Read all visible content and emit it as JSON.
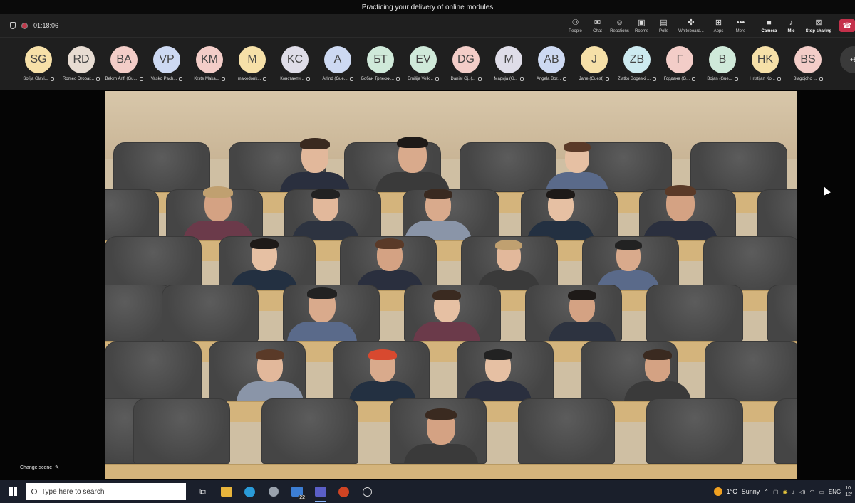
{
  "window": {
    "title": "Practicing your delivery of online modules"
  },
  "meeting": {
    "timer": "01:18:06",
    "toolbar": [
      {
        "id": "people",
        "icon": "people-icon",
        "glyph": "⚇",
        "label": "People"
      },
      {
        "id": "chat",
        "icon": "chat-icon",
        "glyph": "✉",
        "label": "Chat"
      },
      {
        "id": "reactions",
        "icon": "reactions-icon",
        "glyph": "☺",
        "label": "Reactions"
      },
      {
        "id": "rooms",
        "icon": "rooms-icon",
        "glyph": "▣",
        "label": "Rooms"
      },
      {
        "id": "polls",
        "icon": "polls-icon",
        "glyph": "▤",
        "label": "Polls"
      },
      {
        "id": "whiteboard",
        "icon": "whiteboard-icon",
        "glyph": "✣",
        "label": "Whiteboard..."
      },
      {
        "id": "apps",
        "icon": "apps-icon",
        "glyph": "⊞",
        "label": "Apps"
      },
      {
        "id": "more",
        "icon": "more-icon",
        "glyph": "•••",
        "label": "More"
      }
    ],
    "controls": [
      {
        "id": "camera",
        "icon": "camera-icon",
        "glyph": "■",
        "label": "Camera"
      },
      {
        "id": "mic",
        "icon": "mic-icon",
        "glyph": "♪",
        "label": "Mic"
      },
      {
        "id": "share",
        "icon": "stop-sharing-icon",
        "glyph": "⊠",
        "label": "Stop sharing"
      }
    ],
    "leave_glyph": "☎",
    "participants": [
      {
        "initials": "SG",
        "name": "Sofija Glavi...",
        "color": "#f6e0a8"
      },
      {
        "initials": "RD",
        "name": "Romeo Drobar...",
        "color": "#e7dcd2"
      },
      {
        "initials": "BA",
        "name": "Bekim Arifi (Gu...",
        "color": "#f3cdc8"
      },
      {
        "initials": "VP",
        "name": "Vasko Pach...",
        "color": "#cdd9f2"
      },
      {
        "initials": "KM",
        "name": "Krste Maka...",
        "color": "#f3cdc8"
      },
      {
        "initials": "M",
        "name": "makedonk...",
        "color": "#f6e0a8"
      },
      {
        "initials": "KC",
        "name": "Константи...",
        "color": "#dfdde8"
      },
      {
        "initials": "A",
        "name": "Arlind (Gue...",
        "color": "#cdd9f2"
      },
      {
        "initials": "БТ",
        "name": "Бобан Трпески...",
        "color": "#cfe9d9"
      },
      {
        "initials": "EV",
        "name": "Emilija Velk...",
        "color": "#cfe9d9"
      },
      {
        "initials": "DG",
        "name": "Daniel Gj. (...",
        "color": "#f3cdc8"
      },
      {
        "initials": "M",
        "name": "Марија (G...",
        "color": "#dfdde8"
      },
      {
        "initials": "AB",
        "name": "Angela Bor...",
        "color": "#cdd9f2"
      },
      {
        "initials": "J",
        "name": "Jane (Guest)",
        "color": "#f6e0a8"
      },
      {
        "initials": "ZB",
        "name": "Zlatko Bogeski ...",
        "color": "#cdeaf0"
      },
      {
        "initials": "Г",
        "name": "Гордана (G...",
        "color": "#f3cdc8"
      },
      {
        "initials": "B",
        "name": "Bojan (Gue...",
        "color": "#cfe9d9"
      },
      {
        "initials": "HK",
        "name": "Hristijan Ko...",
        "color": "#f6e0a8"
      },
      {
        "initials": "BS",
        "name": "Blagojcho ...",
        "color": "#f3cdc8"
      }
    ],
    "overflow_count": "+5",
    "change_scene": "Change scene"
  },
  "taskbar": {
    "search_placeholder": "Type here to search",
    "badge": "22",
    "weather_temp": "1°C",
    "weather_text": "Sunny",
    "language": "ENG",
    "time": "10:",
    "date": "12/"
  }
}
